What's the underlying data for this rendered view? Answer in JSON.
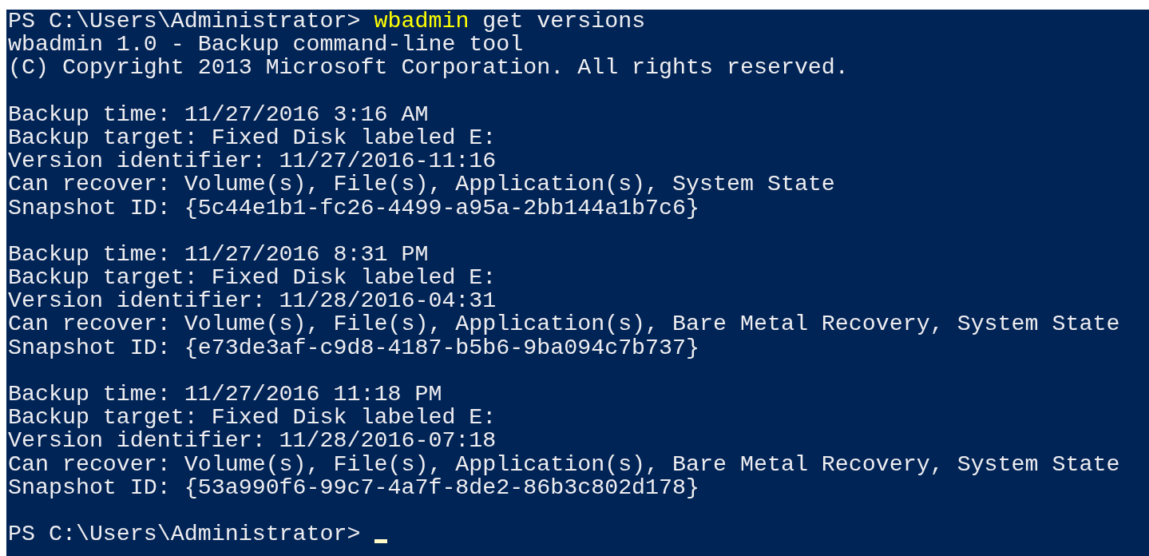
{
  "console": {
    "lines": [
      {
        "kind": "command",
        "prompt": "PS C:\\Users\\Administrator>",
        "command": "wbadmin",
        "args": "get versions"
      },
      {
        "kind": "output",
        "text": "wbadmin 1.0 - Backup command-line tool"
      },
      {
        "kind": "output",
        "text": "(C) Copyright 2013 Microsoft Corporation. All rights reserved."
      },
      {
        "kind": "blank"
      },
      {
        "kind": "output",
        "text": "Backup time: 11/27/2016 3:16 AM"
      },
      {
        "kind": "output",
        "text": "Backup target: Fixed Disk labeled E:"
      },
      {
        "kind": "output",
        "text": "Version identifier: 11/27/2016-11:16"
      },
      {
        "kind": "output",
        "text": "Can recover: Volume(s), File(s), Application(s), System State"
      },
      {
        "kind": "output",
        "text": "Snapshot ID: {5c44e1b1-fc26-4499-a95a-2bb144a1b7c6}"
      },
      {
        "kind": "blank"
      },
      {
        "kind": "output",
        "text": "Backup time: 11/27/2016 8:31 PM"
      },
      {
        "kind": "output",
        "text": "Backup target: Fixed Disk labeled E:"
      },
      {
        "kind": "output",
        "text": "Version identifier: 11/28/2016-04:31"
      },
      {
        "kind": "output",
        "text": "Can recover: Volume(s), File(s), Application(s), Bare Metal Recovery, System State"
      },
      {
        "kind": "output",
        "text": "Snapshot ID: {e73de3af-c9d8-4187-b5b6-9ba094c7b737}"
      },
      {
        "kind": "blank"
      },
      {
        "kind": "output",
        "text": "Backup time: 11/27/2016 11:18 PM"
      },
      {
        "kind": "output",
        "text": "Backup target: Fixed Disk labeled E:"
      },
      {
        "kind": "output",
        "text": "Version identifier: 11/28/2016-07:18"
      },
      {
        "kind": "output",
        "text": "Can recover: Volume(s), File(s), Application(s), Bare Metal Recovery, System State"
      },
      {
        "kind": "output",
        "text": "Snapshot ID: {53a990f6-99c7-4a7f-8de2-86b3c802d178}"
      },
      {
        "kind": "blank"
      },
      {
        "kind": "prompt",
        "prompt": "PS C:\\Users\\Administrator>"
      }
    ]
  }
}
